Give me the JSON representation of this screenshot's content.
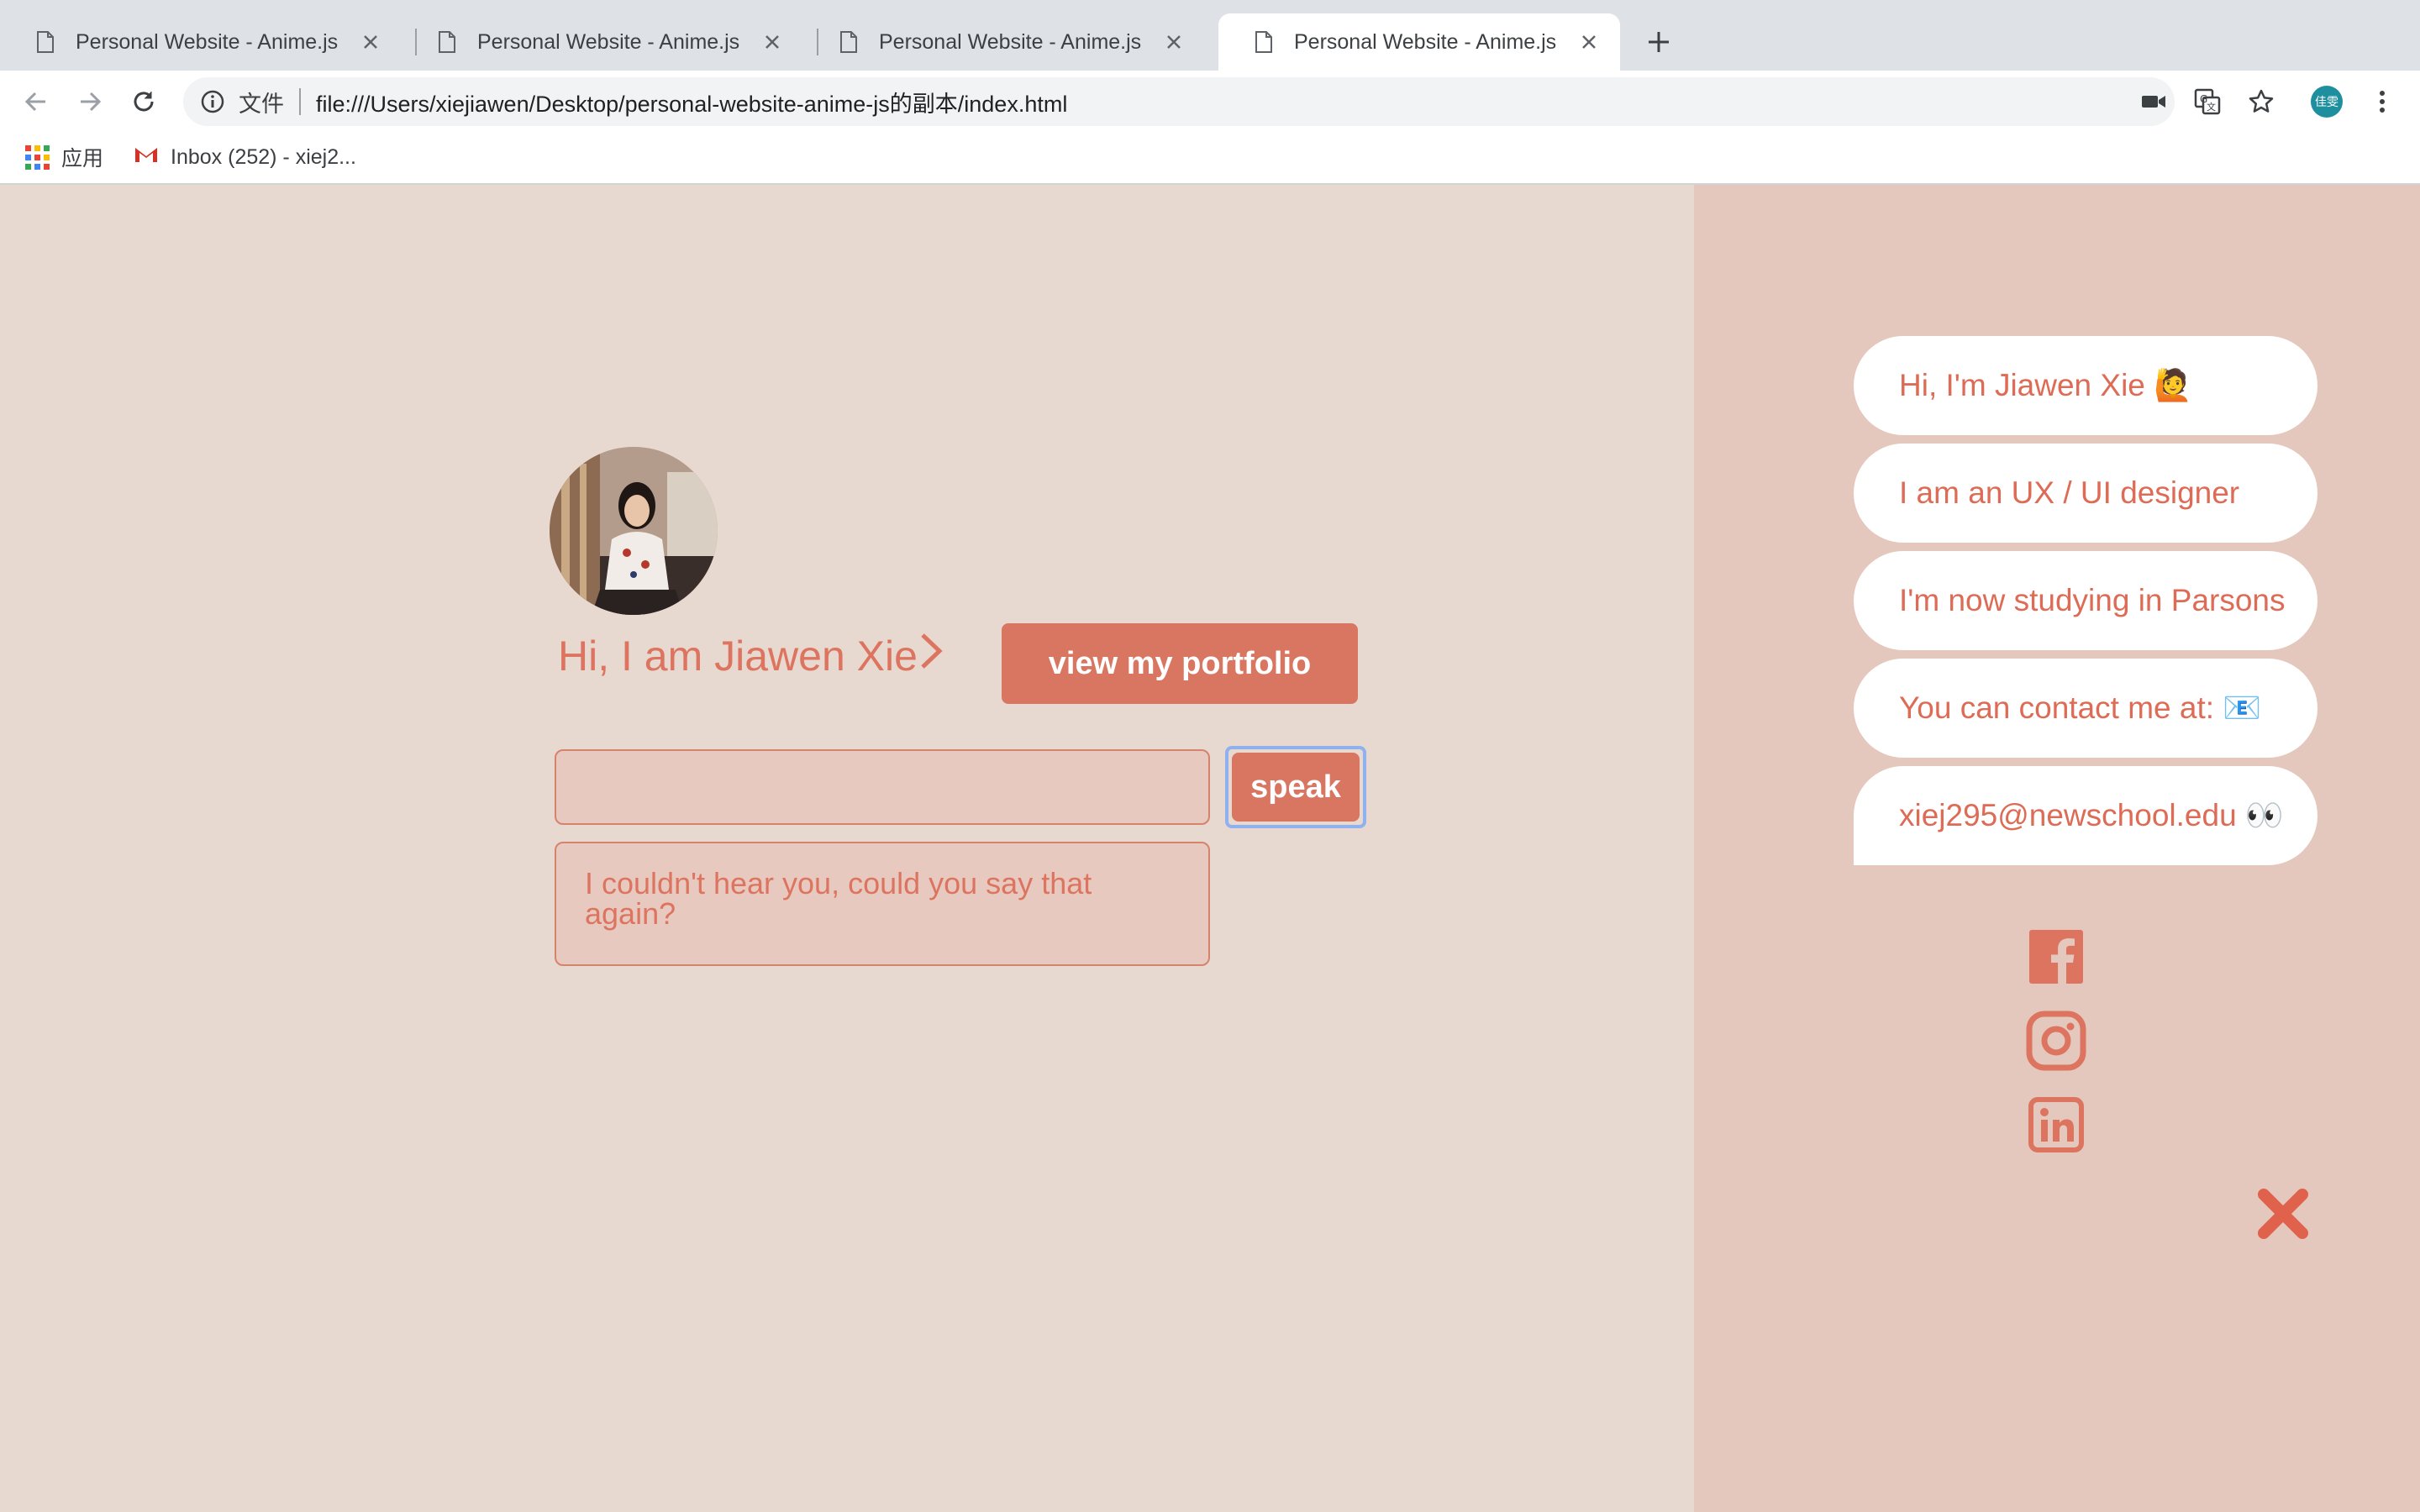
{
  "browser": {
    "tabs": [
      {
        "title": "Personal Website - Anime.js",
        "active": false
      },
      {
        "title": "Personal Website - Anime.js",
        "active": false
      },
      {
        "title": "Personal Website - Anime.js",
        "active": false
      },
      {
        "title": "Personal Website - Anime.js",
        "active": true
      }
    ],
    "omnibox": {
      "scheme_label": "文件",
      "url": "file:///Users/xiejiawen/Desktop/personal-website-anime-js的副本/index.html"
    },
    "profile_initials": "佳雯",
    "bookmarks": {
      "apps_label": "应用",
      "gmail_label": "Inbox (252) - xiej2..."
    }
  },
  "main": {
    "greeting": "Hi, I am Jiawen Xie",
    "portfolio_button": "view my portfolio",
    "speak_input_value": "",
    "speak_button": "speak",
    "response": "I couldn't hear you, could you say that again?"
  },
  "sidebar": {
    "bubbles": [
      "Hi, I'm Jiawen Xie 🙋",
      "I am an UX / UI designer",
      "I'm now studying in Parsons",
      "You can contact me at: 📧",
      "xiej295@newschool.edu 👀"
    ],
    "social_icons": [
      "facebook-icon",
      "instagram-icon",
      "linkedin-icon"
    ]
  },
  "colors": {
    "accent": "#dd7460",
    "button": "#d87661",
    "main_bg": "#e7d8d0",
    "side_bg": "#e4c8bd"
  }
}
